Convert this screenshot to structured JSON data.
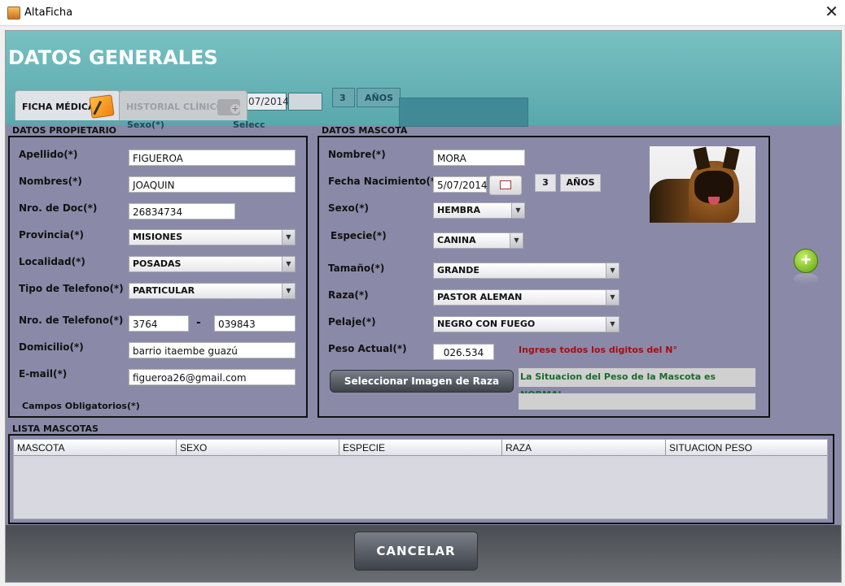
{
  "window": {
    "title": "AltaFicha"
  },
  "header": {
    "title": "DATOS GENERALES"
  },
  "tabs": [
    {
      "label": "FICHA MÉDICA"
    },
    {
      "label": "HISTORIAL CLÍNICO"
    }
  ],
  "ghost": {
    "date": "07/2014",
    "age": "3",
    "age_unit": "AÑOS",
    "sexo": "Sexo(*)",
    "combo": "Selecc"
  },
  "propietario": {
    "section": "DATOS PROPIETARIO",
    "apellido_label": "Apellido(*)",
    "apellido": "FIGUEROA",
    "nombres_label": "Nombres(*)",
    "nombres": "JOAQUIN",
    "doc_label": "Nro. de Doc(*)",
    "doc": "26834734",
    "provincia_label": "Provincia(*)",
    "provincia": "MISIONES",
    "localidad_label": "Localidad(*)",
    "localidad": "POSADAS",
    "tipo_tel_label": "Tipo de Telefono(*)",
    "tipo_tel": "PARTICULAR",
    "tel_label": "Nro. de Telefono(*)",
    "tel_area": "3764",
    "tel_sep": "-",
    "tel_num": "039843",
    "domicilio_label": "Domicilio(*)",
    "domicilio": "barrio itaembe guazú",
    "email_label": "E-mail(*)",
    "email": "figueroa26@gmail.com",
    "obligatorios": "Campos Obligatorios(*)"
  },
  "mascota": {
    "section": "DATOS MASCOTA",
    "nombre_label": "Nombre(*)",
    "nombre": "MORA",
    "fecha_label": "Fecha Nacimiento(*)",
    "fecha": "5/07/2014",
    "edad": "3",
    "edad_unit": "AÑOS",
    "sexo_label": "Sexo(*)",
    "sexo": "HEMBRA",
    "especie_label": "Especie(*)",
    "especie": "CANINA",
    "tamano_label": "Tamaño(*)",
    "tamano": "GRANDE",
    "raza_label": "Raza(*)",
    "raza": "PASTOR ALEMAN",
    "pelaje_label": "Pelaje(*)",
    "pelaje": "NEGRO CON FUEGO",
    "peso_label": "Peso Actual(*)",
    "peso": "026.534",
    "peso_hint": "Ingrese todos los digitos del N°",
    "imagen_button": "Seleccionar Imagen de Raza",
    "situacion": "La Situacion del Peso de la Mascota es NORMAL",
    "situacion2": ""
  },
  "lista": {
    "section": "LISTA MASCOTAS",
    "columns": [
      "MASCOTA",
      "SEXO",
      "ESPECIE",
      "RAZA",
      "SITUACION PESO"
    ]
  },
  "footer": {
    "cancel": "CANCELAR"
  },
  "icons": {
    "app": "java-cup-icon",
    "close": "close-icon",
    "add": "plus-circle-icon",
    "calendar": "calendar-icon",
    "dropdown": "chevron-down-icon"
  },
  "colors": {
    "panel": "#8a8aa8",
    "header": "#6ab4b6",
    "ok_text": "#1a6a30",
    "warn_text": "#a01010"
  }
}
